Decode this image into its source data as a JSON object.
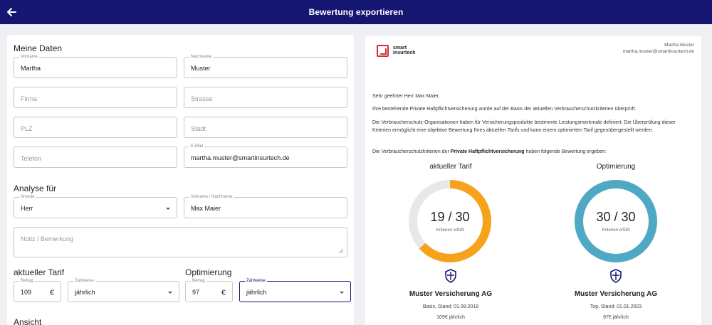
{
  "header": {
    "title": "Bewertung exportieren"
  },
  "form": {
    "section_my_data": "Meine Daten",
    "vorname": {
      "label": "Vorname",
      "value": "Martha"
    },
    "nachname": {
      "label": "Nachname",
      "value": "Muster"
    },
    "firma": {
      "placeholder": "Firma"
    },
    "strasse": {
      "placeholder": "Strasse"
    },
    "plz": {
      "placeholder": "PLZ"
    },
    "stadt": {
      "placeholder": "Stadt"
    },
    "telefon": {
      "placeholder": "Telefon"
    },
    "email": {
      "label": "E-Mail",
      "value": "martha.muster@smartinsurtech.de"
    },
    "section_analysis": "Analyse für",
    "anrede": {
      "label": "Anrede",
      "value": "Herr"
    },
    "fullname": {
      "label": "Vorname / Nachname",
      "value": "Max Maier"
    },
    "notiz": {
      "placeholder": "Notiz / Bemerkung"
    },
    "section_current": "aktueller Tarif",
    "section_opt": "Optimierung",
    "current_betrag": {
      "label": "Betrag",
      "value": "109",
      "currency": "€"
    },
    "current_zahlweise": {
      "label": "Zahlweise",
      "value": "jährlich"
    },
    "opt_betrag": {
      "label": "Betrag",
      "value": "97",
      "currency": "€"
    },
    "opt_zahlweise": {
      "label": "Zahlweise",
      "value": "jährlich"
    },
    "section_view": "Ansicht"
  },
  "preview": {
    "brand_line1": "smart",
    "brand_line2": "insurtech",
    "user_name": "Martha Muster",
    "user_email": "martha.muster@smartinsurtech.de",
    "greeting": "Sehr geehrter Herr Max Maier,",
    "para1": "Ihre bestehende Private Haftpflichtversicherung wurde auf der Basis der aktuellen Verbraucherschutzkriterien überprüft.",
    "para2": "Die Verbraucherschutz-Organisationen haben für Versicherungsprodukte bestimmte Leistungsmerkmale definiert. Die Überprüfung dieser Kriterien ermöglicht eine objektive Bewertung Ihres aktuellen Tarifs und kann einem optimierten Tarif gegenübergestellt werden.",
    "para3_pre": "Die Verbraucherschutzkriterien der ",
    "para3_bold": "Private Haftpflichtversicherung",
    "para3_post": " haben folgende Bewertung ergeben:",
    "current": {
      "heading": "aktueller Tarif",
      "score_text": "19 / 30",
      "score": 19,
      "max": 30,
      "caption": "Kriterien erfüllt",
      "color": "#f7a21b",
      "insurer": "Muster Versicherung AG",
      "tariff": "Basis, Stand: 01.08.2018",
      "price": "109€ jährlich"
    },
    "optimized": {
      "heading": "Optimierung",
      "score_text": "30 / 30",
      "score": 30,
      "max": 30,
      "caption": "Kriterien erfüllt",
      "color": "#4fa9c2",
      "insurer": "Muster Versicherung AG",
      "tariff": "Top, Stand: 01.01.2023",
      "price": "97€ jährlich"
    }
  },
  "colors": {
    "header_bg": "#141672",
    "brand_red": "#d62b35",
    "track": "#e8e8e8"
  }
}
